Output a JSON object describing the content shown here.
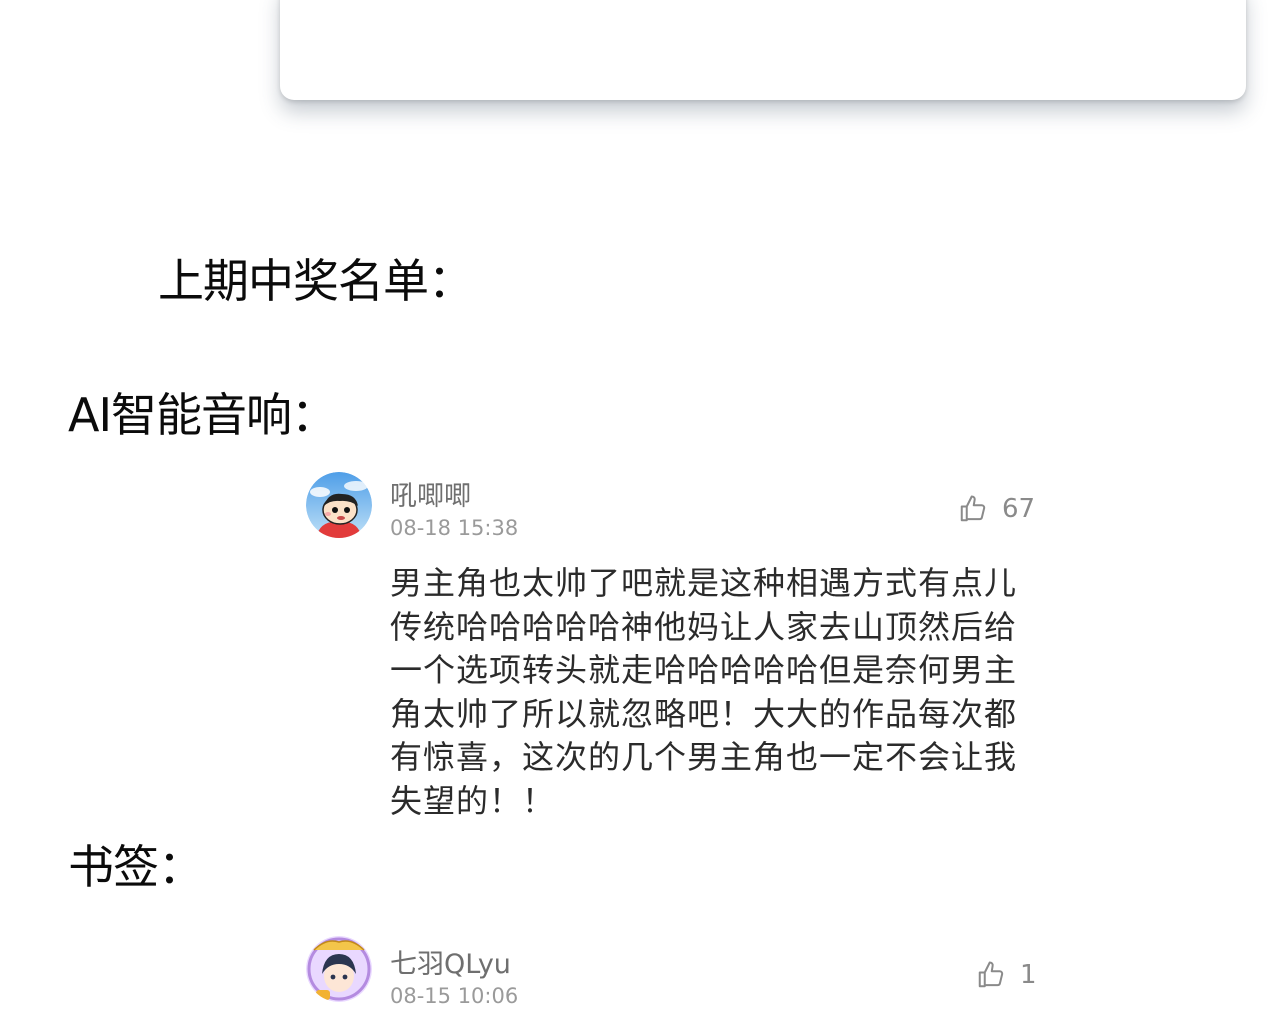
{
  "sections": {
    "winners_title": "上期中奖名单：",
    "speaker_label": "AI智能音响：",
    "bookmark_label": "书签："
  },
  "comments": [
    {
      "username": "吼唧唧",
      "timestamp": "08-18 15:38",
      "likes": "67",
      "avatar_icon": "crayon-boy-avatar",
      "text": "男主角也太帅了吧就是这种相遇方式有点儿传统哈哈哈哈哈神他妈让人家去山顶然后给一个选项转头就走哈哈哈哈哈但是奈何男主角太帅了所以就忽略吧！大大的作品每次都有惊喜，这次的几个男主角也一定不会让我失望的！！"
    },
    {
      "username": "七羽QLyu",
      "timestamp": "08-15 10:06",
      "likes": "1",
      "avatar_icon": "anime-character-avatar"
    }
  ],
  "icons": {
    "like": "thumbs-up-icon"
  },
  "colors": {
    "background": "#ffffff",
    "heading": "#0b0b0b",
    "username": "#6f6f6f",
    "timestamp": "#9a9a9a",
    "body": "#2b2b2b"
  }
}
